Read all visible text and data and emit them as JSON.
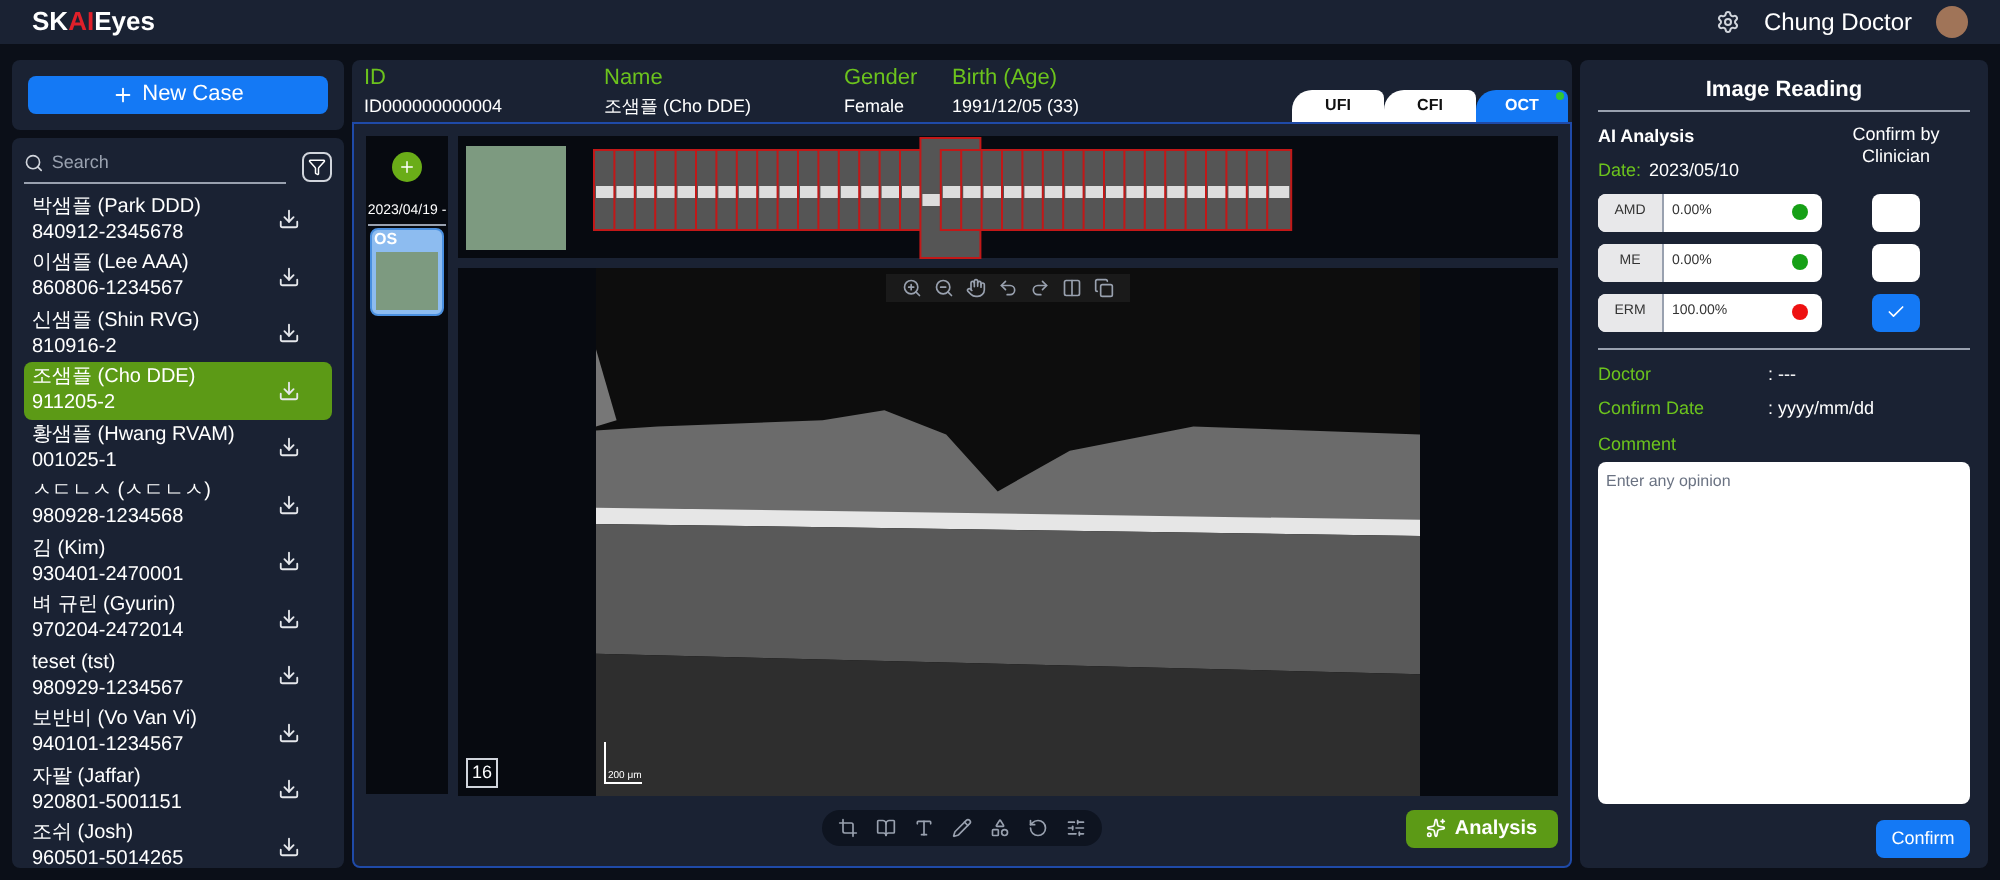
{
  "header": {
    "logo": [
      {
        "text": "SK",
        "kind": "plain"
      },
      {
        "text": "AI",
        "kind": "accent"
      },
      {
        "text": "Eyes",
        "kind": "plain"
      }
    ],
    "user": "Chung Doctor"
  },
  "sidebar": {
    "new_case_button": "New Case",
    "search": {
      "placeholder": "Search"
    },
    "patients": [
      {
        "name": "박샘플 (Park DDD)",
        "id": "840912-2345678",
        "selected": false
      },
      {
        "name": "이샘플 (Lee AAA)",
        "id": "860806-1234567",
        "selected": false
      },
      {
        "name": "신샘플 (Shin RVG)",
        "id": "810916-2",
        "selected": false
      },
      {
        "name": "조샘플 (Cho DDE)",
        "id": "911205-2",
        "selected": true
      },
      {
        "name": "황샘플 (Hwang RVAM)",
        "id": "001025-1",
        "selected": false
      },
      {
        "name": "ㅅㄷㄴㅅ (ㅅㄷㄴㅅ)",
        "id": "980928-1234568",
        "selected": false
      },
      {
        "name": "김 (Kim)",
        "id": "930401-2470001",
        "selected": false
      },
      {
        "name": "벼 규린 (Gyurin)",
        "id": "970204-2472014",
        "selected": false
      },
      {
        "name": "teset (tst)",
        "id": "980929-1234567",
        "selected": false
      },
      {
        "name": "보반비 (Vo Van Vi)",
        "id": "940101-1234567",
        "selected": false
      },
      {
        "name": "자팔 (Jaffar)",
        "id": "920801-5001151",
        "selected": false
      },
      {
        "name": "조쉬 (Josh)",
        "id": "960501-5014265",
        "selected": false
      }
    ]
  },
  "patient": {
    "fields": [
      {
        "label": "ID",
        "value": "ID000000000004"
      },
      {
        "label": "Name",
        "value": "조샘플 (Cho DDE)"
      },
      {
        "label": "Gender",
        "value": "Female"
      },
      {
        "label": "Birth (Age)",
        "value": "1991/12/05 (33)"
      }
    ]
  },
  "tabs": [
    {
      "label": "UFI",
      "selected": false,
      "indicator": false
    },
    {
      "label": "CFI",
      "selected": false,
      "indicator": false
    },
    {
      "label": "OCT",
      "selected": true,
      "indicator": true
    }
  ],
  "viewer": {
    "visits": [
      {
        "date": "2023/04/19 -",
        "eye": "OS",
        "selected": true
      }
    ],
    "slice_number": "16",
    "scale_label": "200 μm",
    "analysis_button": "Analysis"
  },
  "reading": {
    "title": "Image Reading",
    "ai_label": "AI Analysis",
    "date_label": "Date:",
    "date": "2023/05/10",
    "confirm_heading": "Confirm by Clinician",
    "findings": [
      {
        "name": "AMD",
        "value": "0.00%",
        "color": "#16a016",
        "checked": false
      },
      {
        "name": "ME",
        "value": "0.00%",
        "color": "#16a016",
        "checked": false
      },
      {
        "name": "ERM",
        "value": "100.00%",
        "color": "#ee1111",
        "checked": true
      }
    ],
    "doctor_label": "Doctor",
    "doctor_value": ": ---",
    "confirm_date_label": "Confirm Date",
    "confirm_date_value": ": yyyy/mm/dd",
    "comment_label": "Comment",
    "comment_placeholder": "Enter any opinion",
    "confirm_button": "Confirm"
  }
}
